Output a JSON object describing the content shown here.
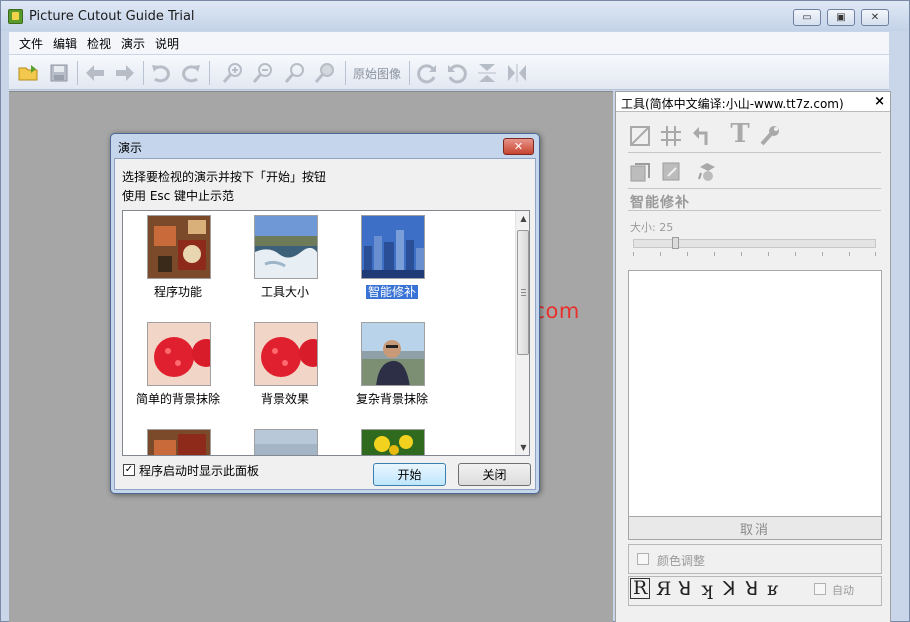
{
  "app": {
    "title": "Picture Cutout Guide Trial",
    "controls": {
      "minimize": "▭",
      "maximize": "▣",
      "close": "✕"
    }
  },
  "menu": [
    "文件",
    "编辑",
    "检视",
    "演示",
    "说明"
  ],
  "toolbar": {
    "icons": [
      "open-icon",
      "save-icon",
      "back-icon",
      "forward-icon",
      "undo-icon",
      "redo-icon",
      "zoom-in-icon",
      "zoom-out-icon",
      "zoom-fit-icon",
      "zoom-actual-icon",
      "rotate-cw-icon",
      "rotate-ccw-icon",
      "flip-vertical-icon",
      "flip-horizontal-icon"
    ],
    "original_image": "原始图像"
  },
  "panel": {
    "title": "工具(简体中文编译:小山-www.tt7z.com)",
    "close": "×",
    "heading": "智能修补",
    "size_label": "大小: 25",
    "brush_size": 25,
    "cancel": "取消",
    "color_adjust": "颜色调整",
    "auto": "自动",
    "glyphs": [
      "R",
      "Я",
      "ꓤ",
      "ʞ",
      "ꓘ",
      "ꓤ",
      "ʁ"
    ]
  },
  "watermark": "www.ouyaoxiazai.com",
  "dialog": {
    "title": "演示",
    "close": "✕",
    "line1": "选择要检视的演示并按下「开始」按钮",
    "line2": "使用 Esc 键中止示范",
    "items": [
      {
        "label": "程序功能",
        "image": "cafe-table"
      },
      {
        "label": "工具大小",
        "image": "waterfall"
      },
      {
        "label": "智能修补",
        "image": "city-skyline",
        "selected": true
      },
      {
        "label": "简单的背景抹除",
        "image": "raspberries"
      },
      {
        "label": "背景效果",
        "image": "raspberries"
      },
      {
        "label": "复杂背景抹除",
        "image": "man-portrait"
      }
    ],
    "checkbox_label": "程序启动时显示此面板",
    "checkbox_checked": true,
    "start": "开始",
    "close_button": "关闭"
  },
  "colors": {
    "titlebar": "#c4d2e8",
    "workspace": "#a6a6a6",
    "selection": "#3a73d6",
    "watermark": "#e8312c"
  }
}
